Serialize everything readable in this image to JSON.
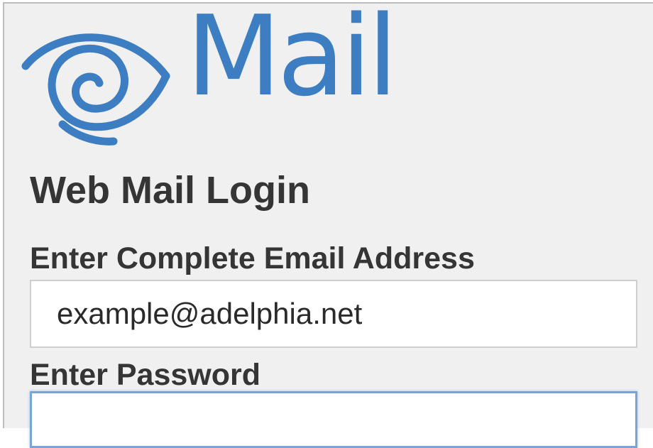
{
  "logo": {
    "icon": "eye-swirl-icon",
    "text": "Mail",
    "color": "#3c7ec1"
  },
  "form": {
    "title": "Web Mail Login",
    "email_label": "Enter Complete Email Address",
    "email_value": "example@adelphia.net",
    "password_label": "Enter Password",
    "password_value": ""
  }
}
